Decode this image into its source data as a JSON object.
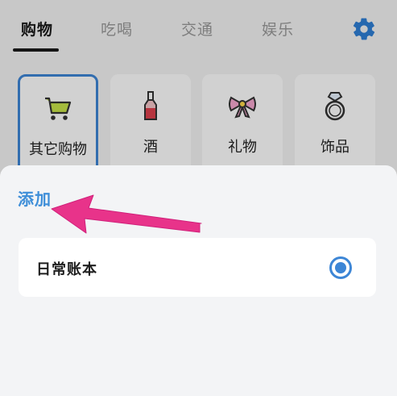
{
  "tabs": [
    {
      "label": "购物",
      "active": true
    },
    {
      "label": "吃喝",
      "active": false
    },
    {
      "label": "交通",
      "active": false
    },
    {
      "label": "娱乐",
      "active": false
    }
  ],
  "settings_icon": "gear-icon",
  "categories": [
    {
      "label": "其它购物",
      "icon": "shopping-cart-icon",
      "selected": true
    },
    {
      "label": "酒",
      "icon": "wine-bottle-icon",
      "selected": false
    },
    {
      "label": "礼物",
      "icon": "gift-bow-icon",
      "selected": false
    },
    {
      "label": "饰品",
      "icon": "ring-icon",
      "selected": false
    }
  ],
  "sheet": {
    "title": "添加",
    "books": [
      {
        "label": "日常账本",
        "selected": true
      }
    ]
  },
  "colors": {
    "accent": "#3d86d6",
    "arrow": "#e8338a"
  }
}
